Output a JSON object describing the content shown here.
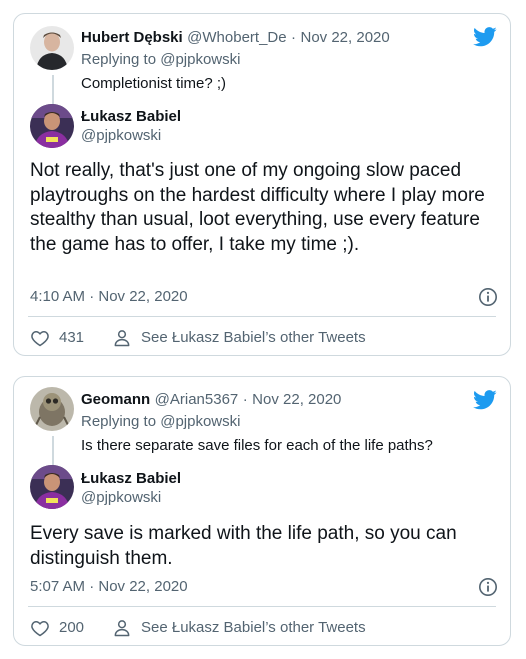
{
  "tweets": [
    {
      "reply": {
        "name": "Hubert Dębski",
        "handle": "@Whobert_De",
        "date_sep": "·",
        "date": "Nov 22, 2020",
        "replying_prefix": "Replying to",
        "replying_to": "@pjpkowski",
        "text": "Completionist time? ;)"
      },
      "main": {
        "name": "Łukasz Babiel",
        "handle": "@pjpkowski",
        "text": "Not really, that's just one of my ongoing slow paced playtroughs on the hardest difficulty where I play more stealthy than usual, loot everything, use every feature the game has to offer, I take my time ;).",
        "timestamp": "4:10 AM · Nov 22, 2020",
        "likes": "431",
        "see_more": "See Łukasz Babiel’s other Tweets"
      }
    },
    {
      "reply": {
        "name": "Geomann",
        "handle": "@Arian5367",
        "date_sep": "·",
        "date": "Nov 22, 2020",
        "replying_prefix": "Replying to",
        "replying_to": "@pjpkowski",
        "text": "Is there separate save files for each of the life paths?"
      },
      "main": {
        "name": "Łukasz Babiel",
        "handle": "@pjpkowski",
        "text": "Every save is marked with the life path, so you can distinguish them.",
        "timestamp": "5:07 AM · Nov 22, 2020",
        "likes": "200",
        "see_more": "See Łukasz Babiel’s other Tweets"
      }
    }
  ],
  "colors": {
    "twitter_blue": "#1d9bf0",
    "border": "#cfd9de",
    "secondary_text": "#536471",
    "primary_text": "#0f1419"
  },
  "icons": [
    "twitter-bird-icon",
    "info-icon",
    "heart-icon",
    "person-icon"
  ]
}
